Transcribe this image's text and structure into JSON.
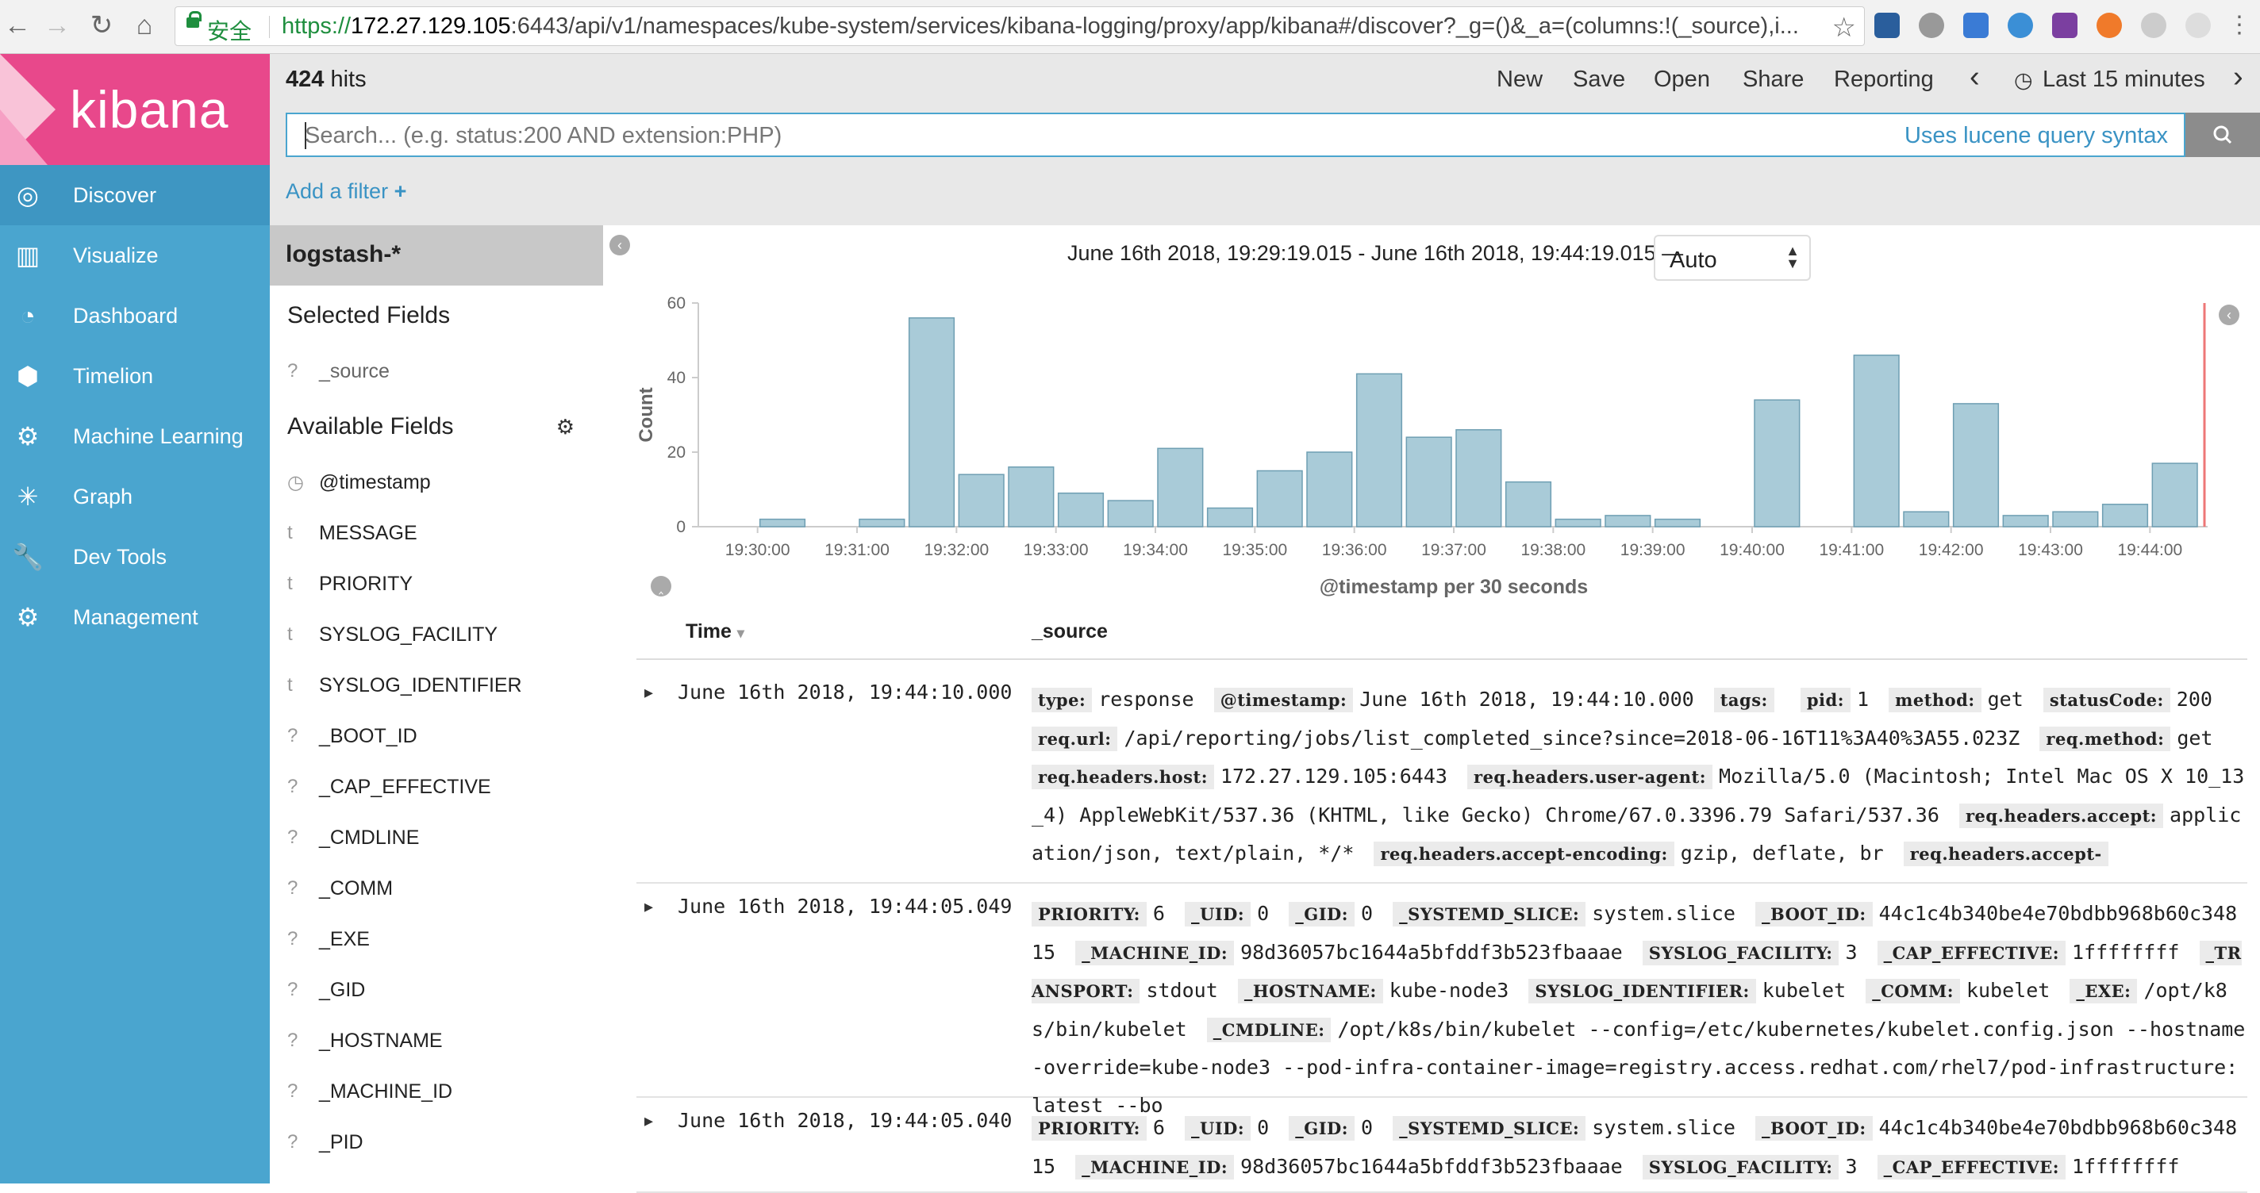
{
  "browser": {
    "secure_label": "安全",
    "url_protocol": "https://",
    "url_host": "172.27.129.105",
    "url_rest": ":6443/api/v1/namespaces/kube-system/services/kibana-logging/proxy/app/kibana#/discover?_g=()&_a=(columns:!(_source),i..."
  },
  "app": {
    "logo": "kibana"
  },
  "sidebar": {
    "items": [
      {
        "label": "Discover",
        "icon": "compass-icon",
        "glyph": "◎"
      },
      {
        "label": "Visualize",
        "icon": "bar-chart-icon",
        "glyph": "▥"
      },
      {
        "label": "Dashboard",
        "icon": "dashboard-icon",
        "glyph": "◔"
      },
      {
        "label": "Timelion",
        "icon": "timelion-icon",
        "glyph": "⬢"
      },
      {
        "label": "Machine Learning",
        "icon": "machine-learning-icon",
        "glyph": "⚙"
      },
      {
        "label": "Graph",
        "icon": "graph-icon",
        "glyph": "✳"
      },
      {
        "label": "Dev Tools",
        "icon": "wrench-icon",
        "glyph": "🔧"
      },
      {
        "label": "Management",
        "icon": "gear-icon",
        "glyph": "⚙"
      }
    ]
  },
  "header": {
    "hits_count": "424",
    "hits_label": " hits",
    "menu": [
      "New",
      "Save",
      "Open",
      "Share",
      "Reporting"
    ],
    "prev": "‹",
    "time_label": "Last 15 minutes",
    "next": "›"
  },
  "query": {
    "placeholder": "Search... (e.g. status:200 AND extension:PHP)",
    "lucene_link": "Uses lucene query syntax"
  },
  "filter": {
    "add_label": "Add a filter",
    "plus": "+"
  },
  "fields": {
    "index_pattern": "logstash-*",
    "selected_title": "Selected Fields",
    "selected": [
      {
        "type": "?",
        "name": "_source"
      }
    ],
    "available_title": "Available Fields",
    "available": [
      {
        "type": "◷",
        "name": "@timestamp"
      },
      {
        "type": "t",
        "name": "MESSAGE"
      },
      {
        "type": "t",
        "name": "PRIORITY"
      },
      {
        "type": "t",
        "name": "SYSLOG_FACILITY"
      },
      {
        "type": "t",
        "name": "SYSLOG_IDENTIFIER"
      },
      {
        "type": "?",
        "name": "_BOOT_ID"
      },
      {
        "type": "?",
        "name": "_CAP_EFFECTIVE"
      },
      {
        "type": "?",
        "name": "_CMDLINE"
      },
      {
        "type": "?",
        "name": "_COMM"
      },
      {
        "type": "?",
        "name": "_EXE"
      },
      {
        "type": "?",
        "name": "_GID"
      },
      {
        "type": "?",
        "name": "_HOSTNAME"
      },
      {
        "type": "?",
        "name": "_MACHINE_ID"
      },
      {
        "type": "?",
        "name": "_PID"
      }
    ]
  },
  "main": {
    "time_range": "June 16th 2018, 19:29:19.015 - June 16th 2018, 19:44:19.015 —",
    "interval": "Auto",
    "columns": [
      "Time",
      "_source"
    ],
    "sort_arrow": "▾"
  },
  "chart_data": {
    "type": "bar",
    "ylabel": "Count",
    "xlabel": "@timestamp per 30 seconds",
    "ylim": [
      0,
      60
    ],
    "yticks": [
      0,
      20,
      40,
      60
    ],
    "xticks": [
      "19:30:00",
      "19:31:00",
      "19:32:00",
      "19:33:00",
      "19:34:00",
      "19:35:00",
      "19:36:00",
      "19:37:00",
      "19:38:00",
      "19:39:00",
      "19:40:00",
      "19:41:00",
      "19:42:00",
      "19:43:00",
      "19:44:00"
    ],
    "categories": [
      "19:29:30",
      "19:30:00",
      "19:30:30",
      "19:31:00",
      "19:31:30",
      "19:32:00",
      "19:32:30",
      "19:33:00",
      "19:33:30",
      "19:34:00",
      "19:34:30",
      "19:35:00",
      "19:35:30",
      "19:36:00",
      "19:36:30",
      "19:37:00",
      "19:37:30",
      "19:38:00",
      "19:38:30",
      "19:39:00",
      "19:39:30",
      "19:40:00",
      "19:40:30",
      "19:41:00",
      "19:41:30",
      "19:42:00",
      "19:42:30",
      "19:43:00",
      "19:43:30",
      "19:44:00"
    ],
    "values": [
      0,
      2,
      0,
      2,
      56,
      14,
      16,
      9,
      7,
      21,
      5,
      15,
      20,
      41,
      24,
      26,
      12,
      2,
      3,
      2,
      0,
      34,
      0,
      46,
      4,
      33,
      3,
      4,
      6,
      17
    ],
    "colors": {
      "bar": "#a9cbd8",
      "bar_stroke": "#6f9fb3",
      "now_line": "#e77"
    },
    "grid": false
  },
  "documents": [
    {
      "time": "June 16th 2018, 19:44:10.000",
      "fields": [
        {
          "k": "type:",
          "v": "response"
        },
        {
          "k": "@timestamp:",
          "v": "June 16th 2018, 19:44:10.000"
        },
        {
          "k": "tags:",
          "v": ""
        },
        {
          "k": "pid:",
          "v": "1"
        },
        {
          "k": "method:",
          "v": "get"
        },
        {
          "k": "statusCode:",
          "v": "200"
        },
        {
          "k": "req.url:",
          "v": "/api/reporting/jobs/list_completed_since?since=2018-06-16T11%3A40%3A55.023Z"
        },
        {
          "k": "req.method:",
          "v": "get"
        },
        {
          "k": "req.headers.host:",
          "v": "172.27.129.105:6443"
        },
        {
          "k": "req.headers.user-agent:",
          "v": "Mozilla/5.0 (Macintosh; Intel Mac OS X 10_13_4) AppleWebKit/537.36 (KHTML, like Gecko) Chrome/67.0.3396.79 Safari/537.36"
        },
        {
          "k": "req.headers.accept:",
          "v": "application/json, text/plain, */*"
        },
        {
          "k": "req.headers.accept-encoding:",
          "v": "gzip, deflate, br"
        },
        {
          "k": "req.headers.accept-",
          "v": ""
        }
      ]
    },
    {
      "time": "June 16th 2018, 19:44:05.049",
      "fields": [
        {
          "k": "PRIORITY:",
          "v": "6"
        },
        {
          "k": "_UID:",
          "v": "0"
        },
        {
          "k": "_GID:",
          "v": "0"
        },
        {
          "k": "_SYSTEMD_SLICE:",
          "v": "system.slice"
        },
        {
          "k": "_BOOT_ID:",
          "v": "44c1c4b340be4e70bdbb968b60c34815"
        },
        {
          "k": "_MACHINE_ID:",
          "v": "98d36057bc1644a5bfddf3b523fbaaae"
        },
        {
          "k": "SYSLOG_FACILITY:",
          "v": "3"
        },
        {
          "k": "_CAP_EFFECTIVE:",
          "v": "1ffffffff"
        },
        {
          "k": "_TRANSPORT:",
          "v": "stdout"
        },
        {
          "k": "_HOSTNAME:",
          "v": "kube-node3"
        },
        {
          "k": "SYSLOG_IDENTIFIER:",
          "v": "kubelet"
        },
        {
          "k": "_COMM:",
          "v": "kubelet"
        },
        {
          "k": "_EXE:",
          "v": "/opt/k8s/bin/kubelet"
        },
        {
          "k": "_CMDLINE:",
          "v": "/opt/k8s/bin/kubelet --config=/etc/kubernetes/kubelet.config.json --hostname-override=kube-node3 --pod-infra-container-image=registry.access.redhat.com/rhel7/pod-infrastructure:latest --bo"
        }
      ]
    },
    {
      "time": "June 16th 2018, 19:44:05.040",
      "fields": [
        {
          "k": "PRIORITY:",
          "v": "6"
        },
        {
          "k": "_UID:",
          "v": "0"
        },
        {
          "k": "_GID:",
          "v": "0"
        },
        {
          "k": "_SYSTEMD_SLICE:",
          "v": "system.slice"
        },
        {
          "k": "_BOOT_ID:",
          "v": "44c1c4b340be4e70bdbb968b60c34815"
        },
        {
          "k": "_MACHINE_ID:",
          "v": "98d36057bc1644a5bfddf3b523fbaaae"
        },
        {
          "k": "SYSLOG_FACILITY:",
          "v": "3"
        },
        {
          "k": "_CAP_EFFECTIVE:",
          "v": "1ffffffff"
        }
      ]
    }
  ]
}
